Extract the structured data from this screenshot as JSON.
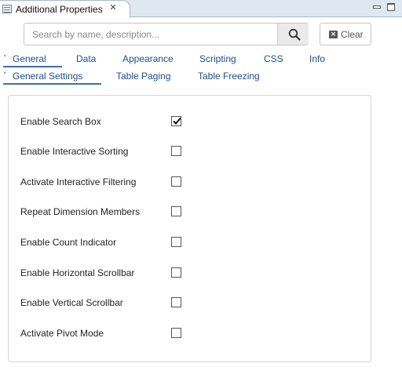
{
  "view": {
    "title": "Additional Properties",
    "close_glyph": "✕"
  },
  "search": {
    "placeholder": "Search by name, description...",
    "value": "",
    "clear_label": "Clear",
    "clear_glyph": "×"
  },
  "category_tabs": [
    {
      "label": "General",
      "active": true
    },
    {
      "label": "Data",
      "active": false
    },
    {
      "label": "Appearance",
      "active": false
    },
    {
      "label": "Scripting",
      "active": false
    },
    {
      "label": "CSS",
      "active": false
    },
    {
      "label": "Info",
      "active": false
    }
  ],
  "sub_tabs": [
    {
      "label": "General Settings",
      "active": true
    },
    {
      "label": "Table Paging",
      "active": false
    },
    {
      "label": "Table Freezing",
      "active": false
    }
  ],
  "settings": [
    {
      "label": "Enable Search Box",
      "checked": true
    },
    {
      "label": "Enable Interactive Sorting",
      "checked": false
    },
    {
      "label": "Activate Interactive Filtering",
      "checked": false
    },
    {
      "label": "Repeat Dimension Members",
      "checked": false
    },
    {
      "label": "Enable Count Indicator",
      "checked": false
    },
    {
      "label": "Enable Horizontal Scrollbar",
      "checked": false
    },
    {
      "label": "Enable Vertical Scrollbar",
      "checked": false
    },
    {
      "label": "Activate Pivot Mode",
      "checked": false
    }
  ],
  "colors": {
    "tab_text": "#1f4e8c",
    "underline": "#3d6eaf",
    "tabstrip_bg": "#dfe7f1"
  },
  "icons": {
    "view": "table-icon",
    "search": "search-icon",
    "clear": "clear-icon",
    "checked": "check-mark-icon"
  }
}
